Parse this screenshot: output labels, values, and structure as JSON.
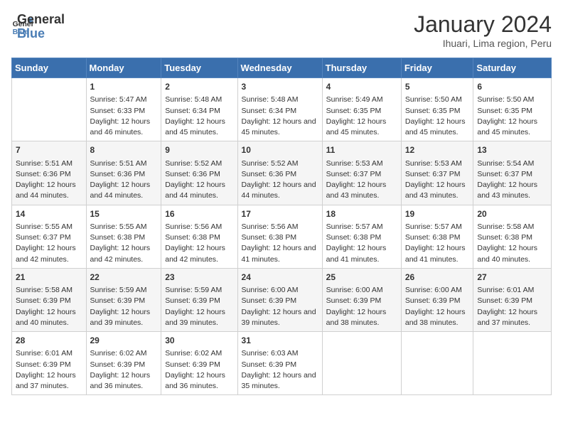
{
  "header": {
    "logo_line1": "General",
    "logo_line2": "Blue",
    "title": "January 2024",
    "subtitle": "Ihuari, Lima region, Peru"
  },
  "columns": [
    "Sunday",
    "Monday",
    "Tuesday",
    "Wednesday",
    "Thursday",
    "Friday",
    "Saturday"
  ],
  "weeks": [
    [
      {
        "day": "",
        "sunrise": "",
        "sunset": "",
        "daylight": ""
      },
      {
        "day": "1",
        "sunrise": "Sunrise: 5:47 AM",
        "sunset": "Sunset: 6:33 PM",
        "daylight": "Daylight: 12 hours and 46 minutes."
      },
      {
        "day": "2",
        "sunrise": "Sunrise: 5:48 AM",
        "sunset": "Sunset: 6:34 PM",
        "daylight": "Daylight: 12 hours and 45 minutes."
      },
      {
        "day": "3",
        "sunrise": "Sunrise: 5:48 AM",
        "sunset": "Sunset: 6:34 PM",
        "daylight": "Daylight: 12 hours and 45 minutes."
      },
      {
        "day": "4",
        "sunrise": "Sunrise: 5:49 AM",
        "sunset": "Sunset: 6:35 PM",
        "daylight": "Daylight: 12 hours and 45 minutes."
      },
      {
        "day": "5",
        "sunrise": "Sunrise: 5:50 AM",
        "sunset": "Sunset: 6:35 PM",
        "daylight": "Daylight: 12 hours and 45 minutes."
      },
      {
        "day": "6",
        "sunrise": "Sunrise: 5:50 AM",
        "sunset": "Sunset: 6:35 PM",
        "daylight": "Daylight: 12 hours and 45 minutes."
      }
    ],
    [
      {
        "day": "7",
        "sunrise": "Sunrise: 5:51 AM",
        "sunset": "Sunset: 6:36 PM",
        "daylight": "Daylight: 12 hours and 44 minutes."
      },
      {
        "day": "8",
        "sunrise": "Sunrise: 5:51 AM",
        "sunset": "Sunset: 6:36 PM",
        "daylight": "Daylight: 12 hours and 44 minutes."
      },
      {
        "day": "9",
        "sunrise": "Sunrise: 5:52 AM",
        "sunset": "Sunset: 6:36 PM",
        "daylight": "Daylight: 12 hours and 44 minutes."
      },
      {
        "day": "10",
        "sunrise": "Sunrise: 5:52 AM",
        "sunset": "Sunset: 6:36 PM",
        "daylight": "Daylight: 12 hours and 44 minutes."
      },
      {
        "day": "11",
        "sunrise": "Sunrise: 5:53 AM",
        "sunset": "Sunset: 6:37 PM",
        "daylight": "Daylight: 12 hours and 43 minutes."
      },
      {
        "day": "12",
        "sunrise": "Sunrise: 5:53 AM",
        "sunset": "Sunset: 6:37 PM",
        "daylight": "Daylight: 12 hours and 43 minutes."
      },
      {
        "day": "13",
        "sunrise": "Sunrise: 5:54 AM",
        "sunset": "Sunset: 6:37 PM",
        "daylight": "Daylight: 12 hours and 43 minutes."
      }
    ],
    [
      {
        "day": "14",
        "sunrise": "Sunrise: 5:55 AM",
        "sunset": "Sunset: 6:37 PM",
        "daylight": "Daylight: 12 hours and 42 minutes."
      },
      {
        "day": "15",
        "sunrise": "Sunrise: 5:55 AM",
        "sunset": "Sunset: 6:38 PM",
        "daylight": "Daylight: 12 hours and 42 minutes."
      },
      {
        "day": "16",
        "sunrise": "Sunrise: 5:56 AM",
        "sunset": "Sunset: 6:38 PM",
        "daylight": "Daylight: 12 hours and 42 minutes."
      },
      {
        "day": "17",
        "sunrise": "Sunrise: 5:56 AM",
        "sunset": "Sunset: 6:38 PM",
        "daylight": "Daylight: 12 hours and 41 minutes."
      },
      {
        "day": "18",
        "sunrise": "Sunrise: 5:57 AM",
        "sunset": "Sunset: 6:38 PM",
        "daylight": "Daylight: 12 hours and 41 minutes."
      },
      {
        "day": "19",
        "sunrise": "Sunrise: 5:57 AM",
        "sunset": "Sunset: 6:38 PM",
        "daylight": "Daylight: 12 hours and 41 minutes."
      },
      {
        "day": "20",
        "sunrise": "Sunrise: 5:58 AM",
        "sunset": "Sunset: 6:38 PM",
        "daylight": "Daylight: 12 hours and 40 minutes."
      }
    ],
    [
      {
        "day": "21",
        "sunrise": "Sunrise: 5:58 AM",
        "sunset": "Sunset: 6:39 PM",
        "daylight": "Daylight: 12 hours and 40 minutes."
      },
      {
        "day": "22",
        "sunrise": "Sunrise: 5:59 AM",
        "sunset": "Sunset: 6:39 PM",
        "daylight": "Daylight: 12 hours and 39 minutes."
      },
      {
        "day": "23",
        "sunrise": "Sunrise: 5:59 AM",
        "sunset": "Sunset: 6:39 PM",
        "daylight": "Daylight: 12 hours and 39 minutes."
      },
      {
        "day": "24",
        "sunrise": "Sunrise: 6:00 AM",
        "sunset": "Sunset: 6:39 PM",
        "daylight": "Daylight: 12 hours and 39 minutes."
      },
      {
        "day": "25",
        "sunrise": "Sunrise: 6:00 AM",
        "sunset": "Sunset: 6:39 PM",
        "daylight": "Daylight: 12 hours and 38 minutes."
      },
      {
        "day": "26",
        "sunrise": "Sunrise: 6:00 AM",
        "sunset": "Sunset: 6:39 PM",
        "daylight": "Daylight: 12 hours and 38 minutes."
      },
      {
        "day": "27",
        "sunrise": "Sunrise: 6:01 AM",
        "sunset": "Sunset: 6:39 PM",
        "daylight": "Daylight: 12 hours and 37 minutes."
      }
    ],
    [
      {
        "day": "28",
        "sunrise": "Sunrise: 6:01 AM",
        "sunset": "Sunset: 6:39 PM",
        "daylight": "Daylight: 12 hours and 37 minutes."
      },
      {
        "day": "29",
        "sunrise": "Sunrise: 6:02 AM",
        "sunset": "Sunset: 6:39 PM",
        "daylight": "Daylight: 12 hours and 36 minutes."
      },
      {
        "day": "30",
        "sunrise": "Sunrise: 6:02 AM",
        "sunset": "Sunset: 6:39 PM",
        "daylight": "Daylight: 12 hours and 36 minutes."
      },
      {
        "day": "31",
        "sunrise": "Sunrise: 6:03 AM",
        "sunset": "Sunset: 6:39 PM",
        "daylight": "Daylight: 12 hours and 35 minutes."
      },
      {
        "day": "",
        "sunrise": "",
        "sunset": "",
        "daylight": ""
      },
      {
        "day": "",
        "sunrise": "",
        "sunset": "",
        "daylight": ""
      },
      {
        "day": "",
        "sunrise": "",
        "sunset": "",
        "daylight": ""
      }
    ]
  ]
}
